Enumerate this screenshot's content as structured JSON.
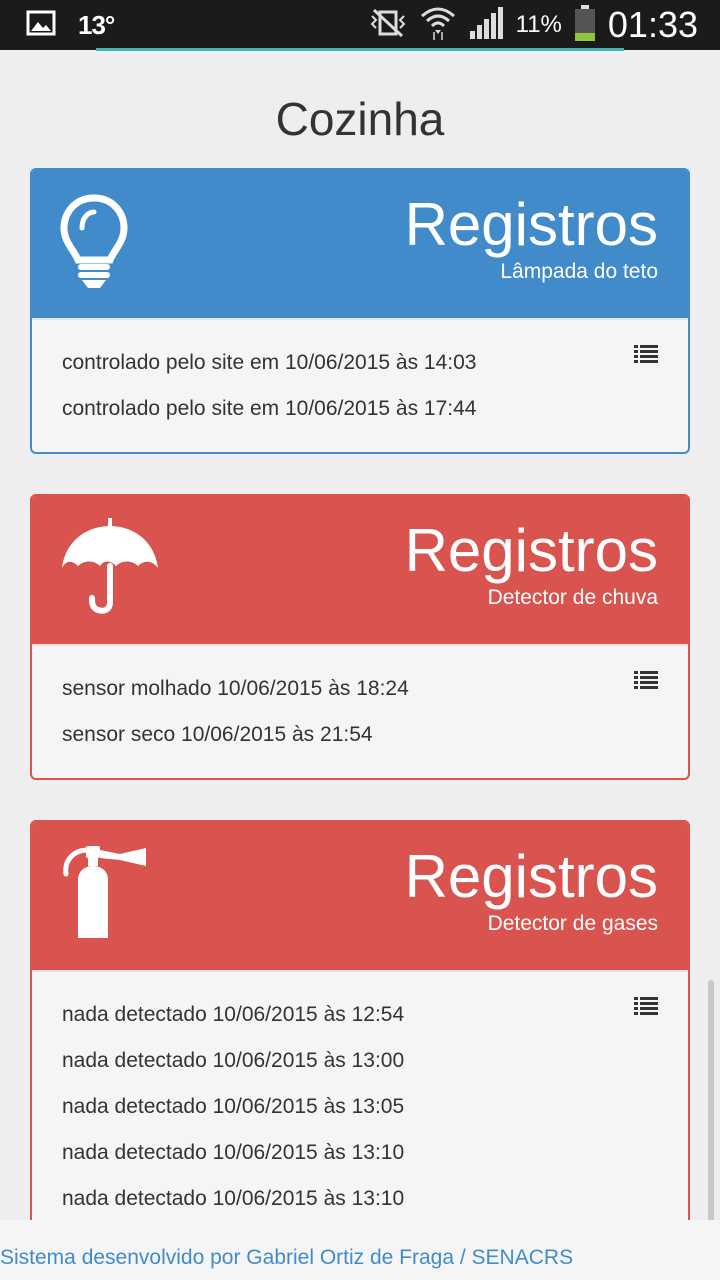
{
  "status_bar": {
    "temperature": "13°",
    "battery_percent": "11%",
    "time": "01:33"
  },
  "page": {
    "title": "Cozinha"
  },
  "panels": [
    {
      "color": "#428bca",
      "icon": "lightbulb-icon",
      "title": "Registros",
      "subtitle": "Lâmpada do teto",
      "entries": [
        "controlado pelo site em 10/06/2015 às 14:03",
        "controlado pelo site em 10/06/2015 às 17:44"
      ]
    },
    {
      "color": "#d9534f",
      "icon": "umbrella-icon",
      "title": "Registros",
      "subtitle": "Detector de chuva",
      "entries": [
        "sensor molhado 10/06/2015 às 18:24",
        "sensor seco 10/06/2015 às 21:54"
      ]
    },
    {
      "color": "#d9534f",
      "icon": "fire-extinguisher-icon",
      "title": "Registros",
      "subtitle": "Detector de gases",
      "entries": [
        "nada detectado 10/06/2015 às 12:54",
        "nada detectado 10/06/2015 às 13:00",
        "nada detectado 10/06/2015 às 13:05",
        "nada detectado 10/06/2015 às 13:10",
        "nada detectado 10/06/2015 às 13:10"
      ]
    }
  ],
  "footer": {
    "text": "Sistema desenvolvido por Gabriel Ortiz de Fraga / SENACRS"
  }
}
